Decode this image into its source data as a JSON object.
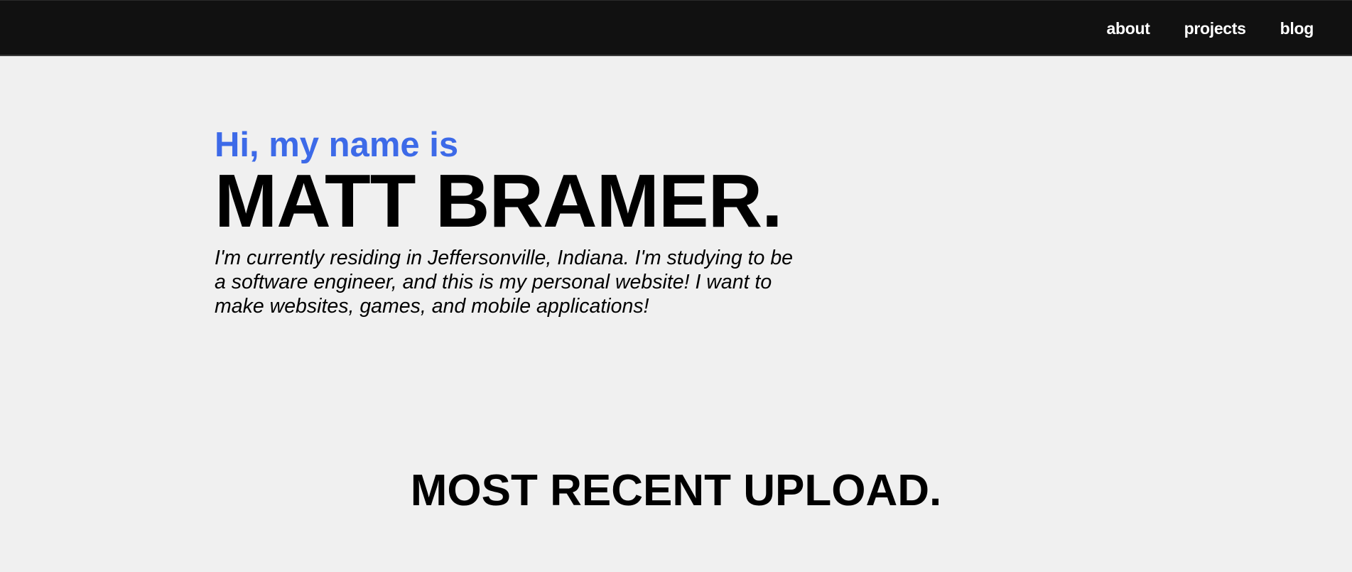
{
  "navbar": {
    "links": [
      {
        "label": "about"
      },
      {
        "label": "projects"
      },
      {
        "label": "blog"
      }
    ]
  },
  "hero": {
    "greeting": "Hi, my name is",
    "name": "MATT BRAMER.",
    "bio": "I'm currently residing in Jeffersonville, Indiana. I'm studying to be a software engineer, and this is my personal website! I want to make websites, games, and mobile applications!"
  },
  "recent": {
    "title": "MOST RECENT UPLOAD."
  },
  "colors": {
    "navbar_bg": "#111111",
    "page_bg": "#f0f0f0",
    "accent": "#3d6ae8",
    "text": "#000000",
    "nav_text": "#ffffff"
  }
}
